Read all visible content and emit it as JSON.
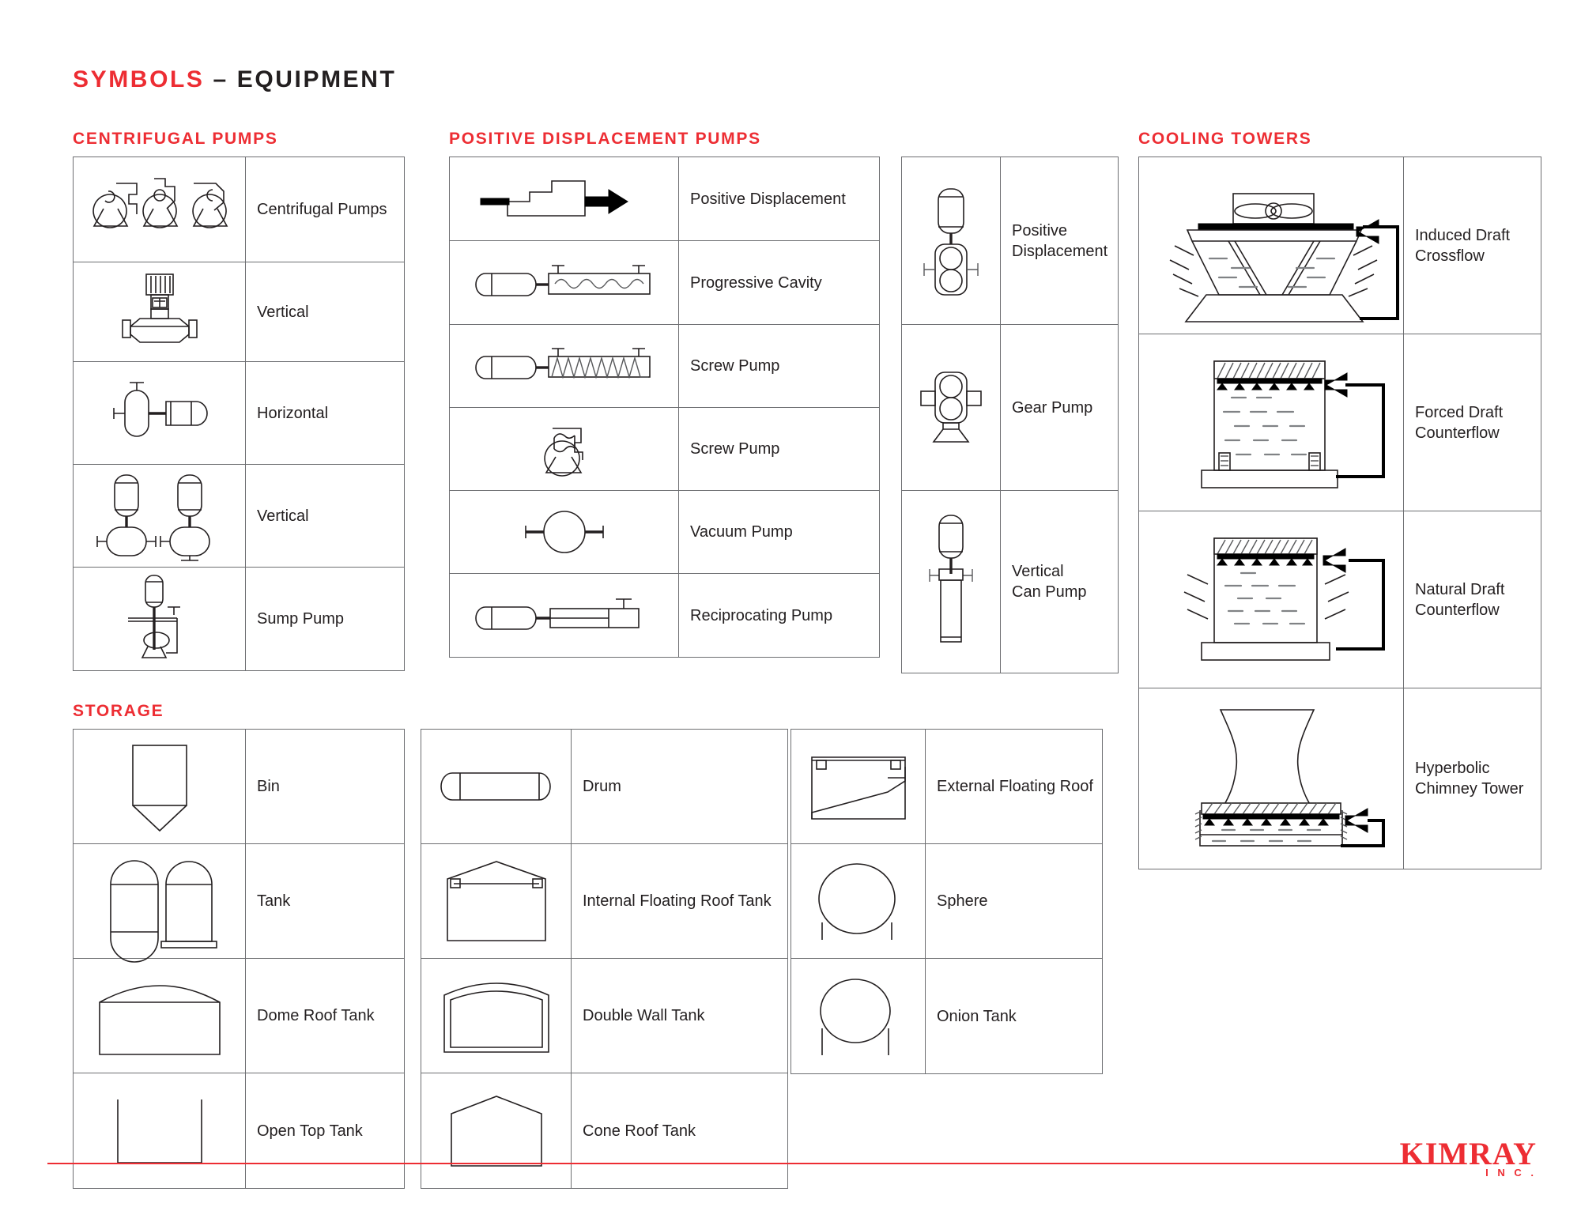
{
  "title": {
    "main": "SYMBOLS",
    "dash": "–",
    "sub": "EQUIPMENT"
  },
  "sections": {
    "centrifugal": {
      "heading": "CENTRIFUGAL PUMPS",
      "rows": [
        {
          "symbol": "centrifugal-pumps-trio",
          "label": "Centrifugal Pumps"
        },
        {
          "symbol": "vertical-inline-pump",
          "label": "Vertical"
        },
        {
          "symbol": "horizontal-pump",
          "label": "Horizontal"
        },
        {
          "symbol": "vertical-pumps-pair",
          "label": "Vertical"
        },
        {
          "symbol": "sump-pump",
          "label": "Sump Pump"
        }
      ]
    },
    "positive_displacement": {
      "heading": "POSITIVE DISPLACEMENT PUMPS",
      "left_rows": [
        {
          "symbol": "pd-block-arrow",
          "label": "Positive Displacement"
        },
        {
          "symbol": "progressive-cavity",
          "label": "Progressive Cavity"
        },
        {
          "symbol": "screw-pump-inline",
          "label": "Screw Pump"
        },
        {
          "symbol": "screw-pump-rotary",
          "label": "Screw Pump"
        },
        {
          "symbol": "vacuum-pump",
          "label": "Vacuum Pump"
        },
        {
          "symbol": "reciprocating-pump",
          "label": "Reciprocating Pump"
        }
      ],
      "right_rows": [
        {
          "symbol": "pd-vertical-gear",
          "label": "Positive\nDisplacement"
        },
        {
          "symbol": "gear-pump",
          "label": "Gear Pump"
        },
        {
          "symbol": "vertical-can-pump",
          "label": "Vertical\nCan Pump"
        }
      ]
    },
    "cooling_towers": {
      "heading": "COOLING TOWERS",
      "rows": [
        {
          "symbol": "induced-draft-crossflow",
          "label": "Induced Draft\nCrossflow"
        },
        {
          "symbol": "forced-draft-counterflow",
          "label": "Forced Draft\nCounterflow"
        },
        {
          "symbol": "natural-draft-counterflow",
          "label": "Natural Draft\nCounterflow"
        },
        {
          "symbol": "hyperbolic-chimney-tower",
          "label": "Hyperbolic\nChimney Tower"
        }
      ]
    },
    "storage": {
      "heading": "STORAGE",
      "col1_rows": [
        {
          "symbol": "bin",
          "label": "Bin"
        },
        {
          "symbol": "tank",
          "label": "Tank"
        },
        {
          "symbol": "dome-roof-tank",
          "label": "Dome Roof Tank"
        },
        {
          "symbol": "open-top-tank",
          "label": "Open Top Tank"
        }
      ],
      "col2_rows": [
        {
          "symbol": "drum",
          "label": "Drum"
        },
        {
          "symbol": "internal-floating-roof-tank",
          "label": "Internal Floating Roof Tank"
        },
        {
          "symbol": "double-wall-tank",
          "label": "Double Wall Tank"
        },
        {
          "symbol": "cone-roof-tank",
          "label": "Cone Roof Tank"
        }
      ],
      "col3_rows": [
        {
          "symbol": "external-floating-roof",
          "label": "External Floating Roof"
        },
        {
          "symbol": "sphere",
          "label": "Sphere"
        },
        {
          "symbol": "onion-tank",
          "label": "Onion Tank"
        }
      ]
    }
  },
  "footer": {
    "logo_main": "KIMRAY",
    "logo_sub": "I N C ."
  },
  "colors": {
    "accent_red": "#ed2d33",
    "text_dark": "#231f20",
    "rule_gray": "#6d6e71"
  }
}
